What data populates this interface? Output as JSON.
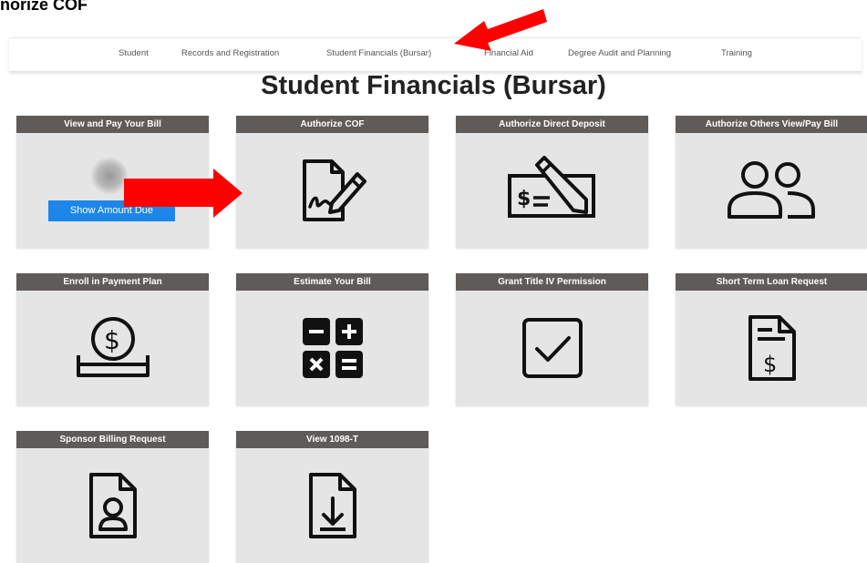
{
  "doc_heading": "norize COF",
  "nav": {
    "items": [
      {
        "label": "Student"
      },
      {
        "label": "Records and Registration"
      },
      {
        "label": "Student Financials (Bursar)"
      },
      {
        "label": "Financial Aid"
      },
      {
        "label": "Degree Audit and Planning"
      },
      {
        "label": "Training"
      }
    ]
  },
  "page_title": "Student Financials (Bursar)",
  "tiles": [
    {
      "title": "View and Pay Your Bill",
      "icon": "blurred-amount",
      "button_label": "Show Amount Due"
    },
    {
      "title": "Authorize COF",
      "icon": "signed-document-icon"
    },
    {
      "title": "Authorize Direct Deposit",
      "icon": "check-pen-icon"
    },
    {
      "title": "Authorize Others View/Pay Bill",
      "icon": "users-icon"
    },
    {
      "title": "Enroll in Payment Plan",
      "icon": "coin-in-tray-icon"
    },
    {
      "title": "Estimate Your Bill",
      "icon": "calculator-icon"
    },
    {
      "title": "Grant Title IV Permission",
      "icon": "checkbox-icon"
    },
    {
      "title": "Short Term Loan Request",
      "icon": "dollar-document-icon"
    },
    {
      "title": "Sponsor Billing Request",
      "icon": "person-document-icon"
    },
    {
      "title": "View 1098-T",
      "icon": "download-document-icon"
    }
  ],
  "colors": {
    "tile_header": "#5f5b59",
    "tile_body": "#e5e5e5",
    "button": "#1d86e8",
    "annotation_arrow": "#ff0000"
  }
}
